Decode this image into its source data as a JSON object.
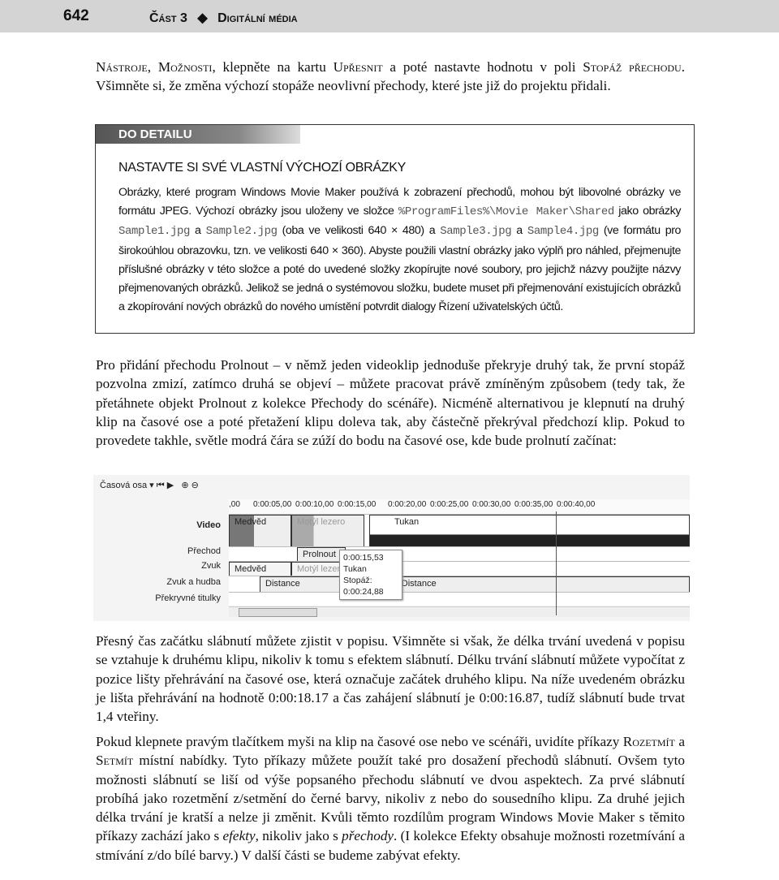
{
  "header": {
    "page_number": "642",
    "part": "Část 3",
    "separator": "◆",
    "chapter": "Digitální média"
  },
  "p1": {
    "s1": "Nástroje, Možnosti",
    "t1": ", klepněte na kartu ",
    "s2": "Upřesnit",
    "t2": " a poté nastavte hodnotu v poli ",
    "s3": "Stopáž přechodu",
    "t3": ". Všimněte si, že změna výchozí stopáže neovlivní přechody, které jste již do projektu přidali."
  },
  "box": {
    "tag": "DO DETAILU",
    "title": "NASTAVTE SI SVÉ VLASTNÍ VÝCHOZÍ OBRÁZKY",
    "t1": "Obrázky, které program Windows Movie Maker používá k zobrazení přechodů, mohou být libovolné obrázky ve formátu JPEG. Výchozí obrázky jsou uloženy ve složce ",
    "c1": "%ProgramFiles%\\Movie Maker\\Shared",
    "t2": " jako obrázky ",
    "c2": "Sample1.jpg",
    "t3": " a ",
    "c3": "Sample2.jpg",
    "t4": " (oba ve velikosti 640 × 480) a ",
    "c4": "Sample3.jpg",
    "t5": " a ",
    "c5": "Sample4.jpg",
    "t6": " (ve formátu pro širokoúhlou obrazovku, tzn. ve velikosti 640 × 360). Abyste použili vlastní obrázky jako výplň pro náhled, přejmenujte příslušné obrázky v této složce a poté do uvedené složky zkopírujte nové soubory, pro jejichž názvy použijte názvy přejmenovaných obrázků. Jelikož se jedná o systémovou složku, budete muset při přejmenování existujících obrázků a zkopírování nových obrázků do nového umístění potvrdit dialogy Řízení uživatelských účtů."
  },
  "p2": "Pro přidání přechodu Prolnout – v němž jeden videoklip jednoduše překryje druhý tak, že první stopáž pozvolna zmizí, zatímco druhá se objeví – můžete pracovat právě zmíněným způsobem (tedy tak, že přetáhnete objekt Prolnout z kolekce Přechody do scénáře). Nicméně alternativou je klepnutí na druhý klip na časové ose a poté přetažení klipu doleva tak, aby částečně překrýval předchozí klip. Pokud to provedete takhle, světle modrá čára se zúží do bodu na časové ose, kde bude prolnutí začínat:",
  "screenshot": {
    "toolbar_label": "Časová osa",
    "ruler": [
      ",00",
      "0:00:05,00",
      "0:00:10,00",
      "0:00:15,00",
      "0:00:20,00",
      "0:00:25,00",
      "0:00:30,00",
      "0:00:35,00",
      "0:00:40,00"
    ],
    "tracks": [
      "Video",
      "Přechod",
      "Zvuk",
      "Zvuk a hudba",
      "Překryvné titulky"
    ],
    "video_clips": [
      "Medvěd",
      "Motýl lezero",
      "Tukan"
    ],
    "transition": "Prolnout",
    "audio_clips": [
      "Medvěd",
      "Motýl lezero"
    ],
    "music": [
      "Distance",
      "Distance"
    ],
    "tooltip": {
      "time": "0:00:15,53",
      "name": "Tukan",
      "duration": "Stopáž: 0:00:24,88"
    }
  },
  "p3": "Přesný čas začátku slábnutí můžete zjistit v popisu. Všimněte si však, že délka trvání uvedená v popisu se vztahuje k druhému klipu, nikoliv k tomu s efektem slábnutí. Délku trvání slábnutí můžete vypočítat z pozice lišty přehrávání na časové ose, která označuje začátek druhého klipu. Na níže uvedeném obrázku je lišta přehrávání na hodnotě 0:00:18.17 a čas zahájení slábnutí je 0:00:16.87, tudíž slábnutí bude trvat 1,4 vteřiny.",
  "p4": {
    "t1": "Pokud klepnete pravým tlačítkem myši na klip na časové ose nebo ve scénáři, uvidíte příkazy ",
    "s1": "Rozetmít",
    "t2": " a ",
    "s2": "Setmít",
    "t3": " místní nabídky. Tyto příkazy můžete použít také pro dosažení přechodů slábnutí. Ovšem tyto možnosti slábnutí se liší od výše popsaného přechodu slábnutí ve dvou aspektech. Za prvé slábnutí probíhá jako rozetmění z/setmění do černé barvy, nikoliv z nebo do sousedního klipu. Za druhé jejich délka trvání je kratší a nelze ji změnit. Kvůli těmto rozdílům program Windows Movie Maker s těmito příkazy zachází jako s ",
    "i1": "efekty",
    "t4": ", nikoliv jako s ",
    "i2": "přechody",
    "t5": ". (I kolekce Efekty obsahuje možnosti rozetmívání a stmívání z/do bílé barvy.) V další části se budeme zabývat efekty."
  }
}
